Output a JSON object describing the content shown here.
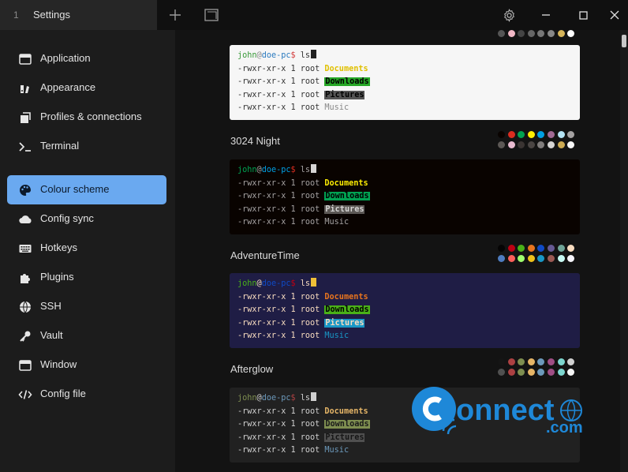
{
  "tab": {
    "number": "1",
    "title": "Settings"
  },
  "sidebar": {
    "items": [
      {
        "label": "Application",
        "icon": "window-icon"
      },
      {
        "label": "Appearance",
        "icon": "brush-icon"
      },
      {
        "label": "Profiles & connections",
        "icon": "layers-icon"
      },
      {
        "label": "Terminal",
        "icon": "terminal-icon"
      },
      {
        "label": "Colour scheme",
        "icon": "palette-icon",
        "active": true
      },
      {
        "label": "Config sync",
        "icon": "cloud-icon"
      },
      {
        "label": "Hotkeys",
        "icon": "keyboard-icon"
      },
      {
        "label": "Plugins",
        "icon": "puzzle-icon"
      },
      {
        "label": "SSH",
        "icon": "globe-icon"
      },
      {
        "label": "Vault",
        "icon": "key-icon"
      },
      {
        "label": "Window",
        "icon": "window-icon"
      },
      {
        "label": "Config file",
        "icon": "code-icon"
      }
    ]
  },
  "terminal_text": {
    "user": "john",
    "at": "@",
    "host": "doe-pc",
    "prompt": "$ ",
    "command": "ls",
    "perm": "-rwxr-xr-x 1 root ",
    "files": [
      "Documents",
      "Downloads",
      "Pictures",
      "Music"
    ]
  },
  "schemes": [
    {
      "name": "",
      "bg": "#f6f6f6",
      "fg": "#333333",
      "user": "#3a9a3a",
      "host": "#2a7abf",
      "dollar": "#d23a3a",
      "at": "#888888",
      "cursor": "#222222",
      "files": [
        {
          "color": "#e0c000",
          "bg": ""
        },
        {
          "color": "#000000",
          "bg": "#26a726"
        },
        {
          "color": "#000000",
          "bg": "#555555"
        },
        {
          "color": "#888888",
          "bg": ""
        }
      ],
      "palette": [
        "#555555",
        "#f2b8c6",
        "#444444",
        "#666666",
        "#777777",
        "#888888",
        "#d6b55a",
        "#ffffff"
      ]
    },
    {
      "name": "3024 Night",
      "bg": "#090300",
      "fg": "#a5a2a2",
      "user": "#01a252",
      "host": "#01a0e4",
      "dollar": "#db2d20",
      "at": "#a5a2a2",
      "cursor": "#d6d5d4",
      "files": [
        {
          "color": "#fded02",
          "bg": ""
        },
        {
          "color": "#000000",
          "bg": "#01a252"
        },
        {
          "color": "#d6d5d4",
          "bg": "#5c5855"
        },
        {
          "color": "#a5a2a2",
          "bg": ""
        }
      ],
      "palette": [
        "#090300",
        "#db2d20",
        "#01a252",
        "#fded02",
        "#01a0e4",
        "#a16a94",
        "#b5e4f4",
        "#a5a2a2",
        "#5c5855",
        "#e8bbd0",
        "#3a3432",
        "#4a4543",
        "#807d7c",
        "#d6d5d4",
        "#cdab53",
        "#f7f7f7"
      ]
    },
    {
      "name": "AdventureTime",
      "bg": "#1f1d45",
      "fg": "#f8dcc0",
      "user": "#4ab118",
      "host": "#0f4ac6",
      "dollar": "#bd0013",
      "at": "#f8dcc0",
      "cursor": "#efbf38",
      "files": [
        {
          "color": "#e7741e",
          "bg": ""
        },
        {
          "color": "#000000",
          "bg": "#4ab118"
        },
        {
          "color": "#f8dcc0",
          "bg": "#1997c6"
        },
        {
          "color": "#1997c6",
          "bg": ""
        }
      ],
      "palette": [
        "#050404",
        "#bd0013",
        "#4ab118",
        "#e7741e",
        "#0f4ac6",
        "#665993",
        "#70a598",
        "#f8dcc0",
        "#4e7cbf",
        "#fc5f5a",
        "#9eff6e",
        "#efc11a",
        "#1997c6",
        "#9b5953",
        "#c8faf4",
        "#f6f5fb"
      ]
    },
    {
      "name": "Afterglow",
      "bg": "#212121",
      "fg": "#d0d0d0",
      "user": "#7e8e50",
      "host": "#6c99bb",
      "dollar": "#ac4142",
      "at": "#d0d0d0",
      "cursor": "#d0d0d0",
      "files": [
        {
          "color": "#e5b567",
          "bg": ""
        },
        {
          "color": "#1a1a1a",
          "bg": "#7e8e50"
        },
        {
          "color": "#151515",
          "bg": "#505050"
        },
        {
          "color": "#6c99bb",
          "bg": ""
        }
      ],
      "palette": [
        "#151515",
        "#ac4142",
        "#7e8e50",
        "#e5b567",
        "#6c99bb",
        "#9f4e85",
        "#7dd6cf",
        "#d0d0d0",
        "#505050",
        "#ac4142",
        "#7e8e50",
        "#e5b567",
        "#6c99bb",
        "#9f4e85",
        "#7dd6cf",
        "#f5f5f5"
      ]
    }
  ],
  "watermark": {
    "text_main": "onnect",
    "text_c": "C",
    "text_sub": ".com"
  }
}
